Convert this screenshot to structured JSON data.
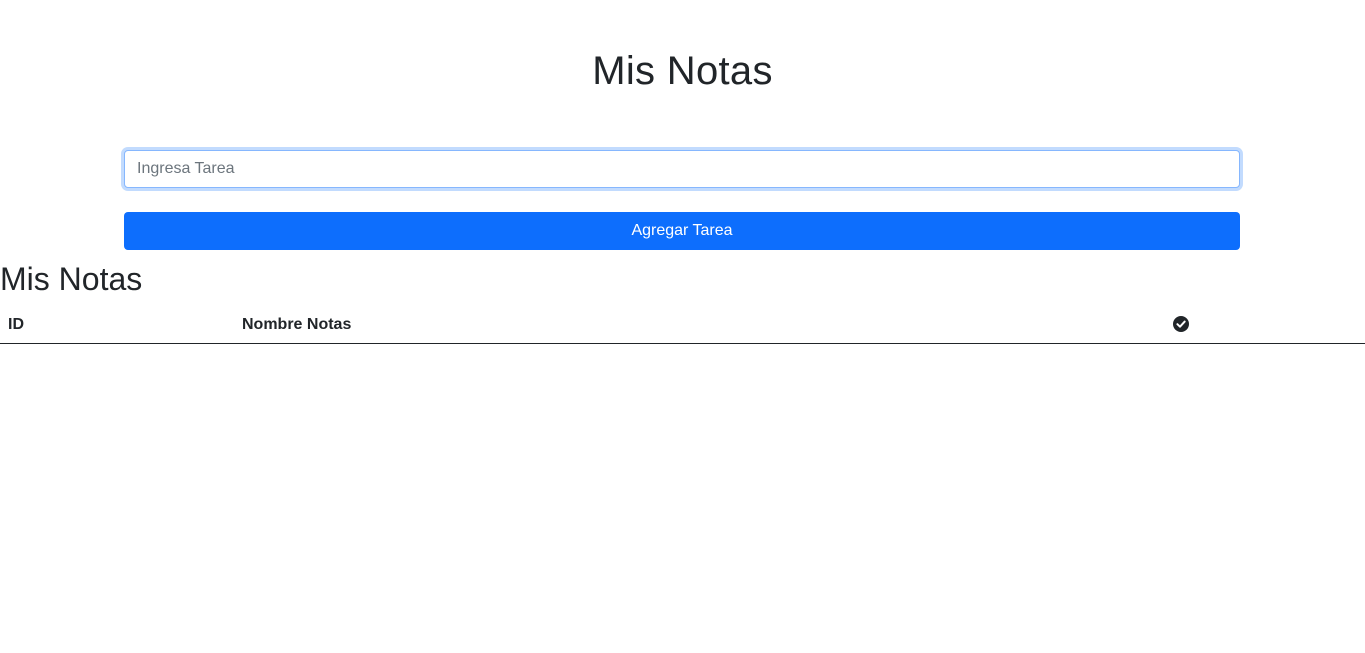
{
  "header": {
    "title": "Mis Notas"
  },
  "form": {
    "input_value": "",
    "input_placeholder": "Ingresa Tarea",
    "submit_label": "Agregar Tarea"
  },
  "notes": {
    "section_title": "Mis Notas",
    "columns": {
      "id": "ID",
      "name": "Nombre Notas",
      "done_icon": "check-circle-icon"
    },
    "rows": []
  },
  "colors": {
    "primary": "#0d6efd",
    "text": "#212529",
    "focus_border": "#86b7fe"
  }
}
